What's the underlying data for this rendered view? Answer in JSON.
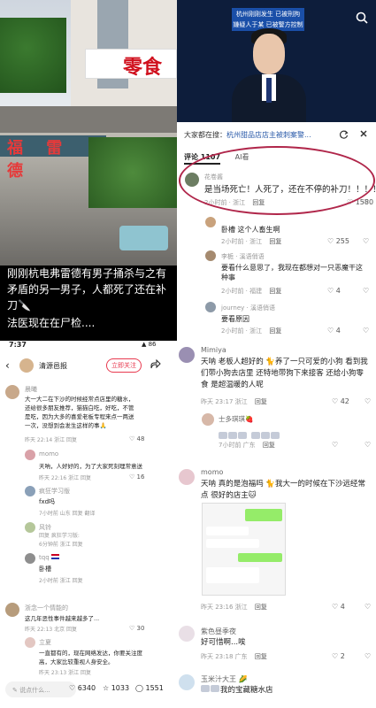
{
  "top_left": {
    "store_sign": "零食",
    "shop_sign": "福 雷 德",
    "caption_1": "刚刚杭电弗雷德有男子捅杀与之有矛盾的另一男子，人都死了还在补刀🔪",
    "caption_2": "法医现在在尸检...."
  },
  "top_right": {
    "video_banner": [
      "杭州刚刚发生 已被刑拘",
      "嫌疑人于某 已被警方控制"
    ],
    "search_prompt_prefix": "大家都在搜：",
    "search_prompt_link": "杭州甜品店店主被刺案警...",
    "tabs": [
      "评论 1107",
      "AI看"
    ],
    "comments": [
      {
        "name": "花卷酱",
        "text": "是当场死亡！人死了，还在不停的补刀！！！！",
        "meta": "2小时前 · 浙江",
        "reply": "回复",
        "likes": "1580"
      },
      {
        "name": "",
        "text": "卧槽 这个人畜生啊",
        "meta": "2小时前 · 浙江",
        "reply": "回复",
        "likes": "255"
      },
      {
        "name": "李栀",
        "name2": "· 溪语俏语",
        "text": "要看什么意思了，我现在都想对一只恶魔干这种事",
        "meta": "2小时前 · 福建",
        "reply": "回复",
        "likes": "4"
      },
      {
        "name": "journey",
        "name2": "· 溪语俏语",
        "text": "要看原因",
        "meta": "2小时前 · 浙江",
        "reply": "回复",
        "likes": "4"
      }
    ]
  },
  "bottom_left": {
    "status_time": "7:37",
    "status_icons": "▲ 86",
    "profile_name": "清源邑报",
    "follow_label": "立即关注",
    "comments": [
      {
        "name": "晨曦",
        "text": "大一大二在下沙的时候经常点店里的糖水，还给很多朋友推荐，猫猫白吃，好吃，不管是吃，因为大多的喜爱老板专程来点一两送一次，没想到会发生这样的事🙏",
        "meta": "昨天 22:14 浙江  回复",
        "likes": "48"
      },
      {
        "name": "momo",
        "text": "天呐，人好好的，为了大家死刻理常意送",
        "meta": "昨天 22:16 浙江  回复",
        "likes": "16"
      },
      {
        "name": "疯狂学习版",
        "text": "fxd吗",
        "meta": "7小时前 山东  回复  翻译",
        "likes": ""
      },
      {
        "name": "风铃",
        "name2": "回复 疯狂学习版:",
        "text": "卧槽",
        "meta": "6分钟前 浙江  回复",
        "likes": ""
      },
      {
        "name": "tqq",
        "text": "卧槽",
        "meta": "2小时前 浙江  回复",
        "likes": ""
      },
      {
        "name": "浙念一个情能的",
        "text": "这几年恶性事件越来越多了...",
        "meta": "昨天 22:13 北京  回复",
        "likes": "30"
      },
      {
        "name": "立夏",
        "text": "一直都有的，现在网络发达，你要关注度高，大家比较重视人身安全。",
        "meta": "昨天 23:13 浙江  回复",
        "likes": ""
      }
    ],
    "bottom_bar": {
      "input_placeholder": "说点什么...",
      "likes": "6340",
      "stars": "1033",
      "comments": "1551"
    }
  },
  "bottom_right": {
    "comments": [
      {
        "name": "Mimiya",
        "text": "天呐 老板人超好的 🐈养了一只可爱的小狗 看到我们带小狗去店里 还特地带狗下来接客 还给小狗零食 是超温暖的人呢",
        "meta": "昨天 23:17 浙江",
        "reply": "回复",
        "likes": "42"
      },
      {
        "name": "士多琪琪🍓",
        "text": "",
        "meta": "7小时前 广东",
        "reply": "回复",
        "likes": ""
      },
      {
        "name": "momo",
        "text": "天呐 真的是泡福吗 🐈我大一的时候在下沙远经常点 很好的店主🐱",
        "meta": "昨天 23:16 浙江",
        "reply": "回复",
        "likes": "4"
      },
      {
        "name": "紫色昼季夜",
        "text": "好可惜啊...唉",
        "meta": "昨天 23:18 广东",
        "reply": "回复",
        "likes": "2"
      },
      {
        "name": "玉米汁大王 🌽",
        "text": "我的宝藏糖水店",
        "meta": "",
        "reply": "",
        "likes": ""
      }
    ]
  }
}
